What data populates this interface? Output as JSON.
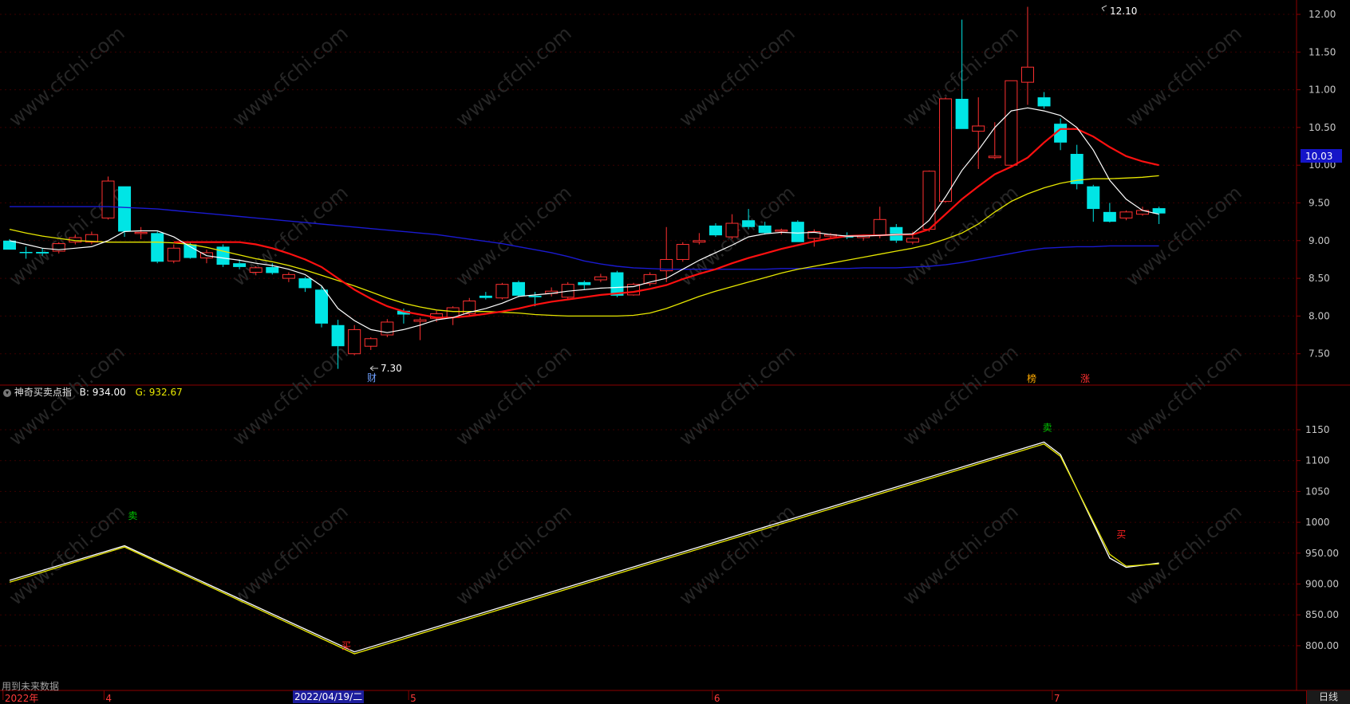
{
  "colors": {
    "up": "#ff3030",
    "down": "#00e5e5",
    "ma5": "#ffffff",
    "ma10": "#ff1010",
    "ma20": "#e6e600",
    "ma60": "#1a1ad0",
    "border": "#8b0000",
    "ind_b": "#ffffff",
    "ind_g": "#e8e800"
  },
  "price_axis": {
    "ticks": [
      "12.00",
      "11.50",
      "11.00",
      "10.50",
      "10.00",
      "9.50",
      "9.00",
      "8.50",
      "8.00",
      "7.50"
    ],
    "current_value": "10.03"
  },
  "annotations": {
    "high_label": "12.10",
    "low_label": "7.30",
    "markers": [
      "财",
      "榜",
      "涨"
    ]
  },
  "indicator": {
    "name": "神奇买卖点指",
    "b_text": "B: 934.00",
    "g_text": "G: 932.67",
    "ticks": [
      "1150",
      "1100",
      "1050",
      "1000",
      "950.00",
      "900.00",
      "850.00",
      "800.00"
    ],
    "signals": [
      "卖",
      "买",
      "卖",
      "买"
    ]
  },
  "x_axis": {
    "labels": [
      "2022年",
      "4",
      "5",
      "6",
      "7"
    ],
    "highlight_date": "2022/04/19/二",
    "period": "日线"
  },
  "notice": "用到未来数据",
  "watermark": "www.cfchi.com",
  "chart_data": [
    {
      "type": "candlestick",
      "ylim": [
        7.1,
        12.15
      ],
      "candles": [
        {
          "o": 9.0,
          "h": 9.02,
          "l": 8.88,
          "c": 8.88,
          "d": 1
        },
        {
          "o": 8.85,
          "h": 8.92,
          "l": 8.76,
          "c": 8.84,
          "d": 1
        },
        {
          "o": 8.85,
          "h": 8.9,
          "l": 8.8,
          "c": 8.83,
          "d": 1
        },
        {
          "o": 8.86,
          "h": 8.98,
          "l": 8.83,
          "c": 8.96,
          "d": 0
        },
        {
          "o": 8.98,
          "h": 9.08,
          "l": 8.95,
          "c": 9.04,
          "d": 0
        },
        {
          "o": 8.98,
          "h": 9.12,
          "l": 8.95,
          "c": 9.08,
          "d": 0
        },
        {
          "o": 9.3,
          "h": 9.85,
          "l": 9.28,
          "c": 9.79,
          "d": 0
        },
        {
          "o": 9.72,
          "h": 9.72,
          "l": 9.05,
          "c": 9.12,
          "d": 1
        },
        {
          "o": 9.1,
          "h": 9.18,
          "l": 9.02,
          "c": 9.11,
          "d": 0
        },
        {
          "o": 9.1,
          "h": 9.12,
          "l": 8.7,
          "c": 8.72,
          "d": 1
        },
        {
          "o": 8.73,
          "h": 8.95,
          "l": 8.7,
          "c": 8.9,
          "d": 0
        },
        {
          "o": 8.95,
          "h": 8.98,
          "l": 8.76,
          "c": 8.77,
          "d": 1
        },
        {
          "o": 8.77,
          "h": 8.88,
          "l": 8.7,
          "c": 8.84,
          "d": 0
        },
        {
          "o": 8.92,
          "h": 8.95,
          "l": 8.65,
          "c": 8.68,
          "d": 1
        },
        {
          "o": 8.7,
          "h": 8.75,
          "l": 8.62,
          "c": 8.65,
          "d": 1
        },
        {
          "o": 8.58,
          "h": 8.66,
          "l": 8.54,
          "c": 8.64,
          "d": 0
        },
        {
          "o": 8.65,
          "h": 8.7,
          "l": 8.55,
          "c": 8.57,
          "d": 1
        },
        {
          "o": 8.5,
          "h": 8.58,
          "l": 8.45,
          "c": 8.55,
          "d": 0
        },
        {
          "o": 8.5,
          "h": 8.52,
          "l": 8.32,
          "c": 8.37,
          "d": 1
        },
        {
          "o": 8.35,
          "h": 8.4,
          "l": 7.85,
          "c": 7.9,
          "d": 1
        },
        {
          "o": 7.88,
          "h": 7.95,
          "l": 7.3,
          "c": 7.6,
          "d": 1
        },
        {
          "o": 7.5,
          "h": 7.88,
          "l": 7.48,
          "c": 7.82,
          "d": 0
        },
        {
          "o": 7.6,
          "h": 7.72,
          "l": 7.55,
          "c": 7.7,
          "d": 0
        },
        {
          "o": 7.75,
          "h": 7.96,
          "l": 7.72,
          "c": 7.92,
          "d": 0
        },
        {
          "o": 8.07,
          "h": 8.1,
          "l": 7.9,
          "c": 8.02,
          "d": 1
        },
        {
          "o": 7.93,
          "h": 7.98,
          "l": 7.68,
          "c": 7.95,
          "d": 0
        },
        {
          "o": 7.97,
          "h": 8.07,
          "l": 7.92,
          "c": 8.03,
          "d": 0
        },
        {
          "o": 7.98,
          "h": 8.13,
          "l": 7.88,
          "c": 8.11,
          "d": 0
        },
        {
          "o": 8.03,
          "h": 8.24,
          "l": 8.0,
          "c": 8.2,
          "d": 0
        },
        {
          "o": 8.27,
          "h": 8.32,
          "l": 8.22,
          "c": 8.24,
          "d": 1
        },
        {
          "o": 8.24,
          "h": 8.44,
          "l": 8.22,
          "c": 8.42,
          "d": 0
        },
        {
          "o": 8.45,
          "h": 8.47,
          "l": 8.25,
          "c": 8.27,
          "d": 1
        },
        {
          "o": 8.27,
          "h": 8.32,
          "l": 8.13,
          "c": 8.25,
          "d": 1
        },
        {
          "o": 8.3,
          "h": 8.38,
          "l": 8.26,
          "c": 8.33,
          "d": 0
        },
        {
          "o": 8.25,
          "h": 8.45,
          "l": 8.22,
          "c": 8.42,
          "d": 0
        },
        {
          "o": 8.45,
          "h": 8.47,
          "l": 8.35,
          "c": 8.41,
          "d": 1
        },
        {
          "o": 8.48,
          "h": 8.56,
          "l": 8.45,
          "c": 8.52,
          "d": 0
        },
        {
          "o": 8.58,
          "h": 8.6,
          "l": 8.25,
          "c": 8.27,
          "d": 1
        },
        {
          "o": 8.28,
          "h": 8.44,
          "l": 8.27,
          "c": 8.42,
          "d": 0
        },
        {
          "o": 8.43,
          "h": 8.58,
          "l": 8.4,
          "c": 8.55,
          "d": 0
        },
        {
          "o": 8.6,
          "h": 9.18,
          "l": 8.45,
          "c": 8.75,
          "d": 0
        },
        {
          "o": 8.75,
          "h": 8.98,
          "l": 8.72,
          "c": 8.95,
          "d": 0
        },
        {
          "o": 8.98,
          "h": 9.1,
          "l": 8.95,
          "c": 9.0,
          "d": 0
        },
        {
          "o": 9.2,
          "h": 9.23,
          "l": 9.05,
          "c": 9.07,
          "d": 1
        },
        {
          "o": 9.05,
          "h": 9.35,
          "l": 9.02,
          "c": 9.23,
          "d": 0
        },
        {
          "o": 9.27,
          "h": 9.42,
          "l": 9.15,
          "c": 9.18,
          "d": 1
        },
        {
          "o": 9.2,
          "h": 9.25,
          "l": 9.08,
          "c": 9.1,
          "d": 1
        },
        {
          "o": 9.13,
          "h": 9.16,
          "l": 9.08,
          "c": 9.14,
          "d": 0
        },
        {
          "o": 9.25,
          "h": 9.27,
          "l": 8.98,
          "c": 8.98,
          "d": 1
        },
        {
          "o": 9.03,
          "h": 9.15,
          "l": 8.92,
          "c": 9.12,
          "d": 0
        },
        {
          "o": 9.06,
          "h": 9.1,
          "l": 9.02,
          "c": 9.08,
          "d": 0
        },
        {
          "o": 9.07,
          "h": 9.11,
          "l": 9.02,
          "c": 9.04,
          "d": 1
        },
        {
          "o": 9.04,
          "h": 9.08,
          "l": 9.0,
          "c": 9.07,
          "d": 0
        },
        {
          "o": 9.07,
          "h": 9.45,
          "l": 9.03,
          "c": 9.28,
          "d": 0
        },
        {
          "o": 9.18,
          "h": 9.22,
          "l": 8.97,
          "c": 9.0,
          "d": 1
        },
        {
          "o": 8.98,
          "h": 9.12,
          "l": 8.95,
          "c": 9.03,
          "d": 0
        },
        {
          "o": 9.15,
          "h": 9.93,
          "l": 9.12,
          "c": 9.92,
          "d": 0
        },
        {
          "o": 9.52,
          "h": 10.9,
          "l": 9.5,
          "c": 10.88,
          "d": 0
        },
        {
          "o": 10.88,
          "h": 11.93,
          "l": 10.48,
          "c": 10.48,
          "d": 1
        },
        {
          "o": 10.45,
          "h": 10.9,
          "l": 9.95,
          "c": 10.52,
          "d": 0
        },
        {
          "o": 10.12,
          "h": 10.57,
          "l": 10.08,
          "c": 10.1,
          "d": 0
        },
        {
          "o": 10.0,
          "h": 11.12,
          "l": 9.98,
          "c": 11.12,
          "d": 0
        },
        {
          "o": 11.1,
          "h": 12.1,
          "l": 10.8,
          "c": 11.3,
          "d": 0
        },
        {
          "o": 10.9,
          "h": 10.97,
          "l": 10.75,
          "c": 10.78,
          "d": 1
        },
        {
          "o": 10.55,
          "h": 10.62,
          "l": 10.2,
          "c": 10.3,
          "d": 1
        },
        {
          "o": 10.15,
          "h": 10.27,
          "l": 9.68,
          "c": 9.75,
          "d": 1
        },
        {
          "o": 9.72,
          "h": 9.74,
          "l": 9.25,
          "c": 9.42,
          "d": 1
        },
        {
          "o": 9.38,
          "h": 9.5,
          "l": 9.24,
          "c": 9.25,
          "d": 1
        },
        {
          "o": 9.3,
          "h": 9.4,
          "l": 9.27,
          "c": 9.38,
          "d": 0
        },
        {
          "o": 9.35,
          "h": 9.45,
          "l": 9.33,
          "c": 9.4,
          "d": 0
        },
        {
          "o": 9.43,
          "h": 9.45,
          "l": 9.22,
          "c": 9.36,
          "d": 1
        }
      ],
      "series": [
        {
          "name": "ma5",
          "values": [
            9.0,
            8.95,
            8.9,
            8.88,
            8.9,
            8.92,
            9.0,
            9.12,
            9.13,
            9.13,
            9.05,
            8.92,
            8.8,
            8.77,
            8.74,
            8.7,
            8.67,
            8.62,
            8.55,
            8.4,
            8.1,
            7.94,
            7.82,
            7.78,
            7.82,
            7.88,
            7.95,
            7.98,
            8.05,
            8.1,
            8.17,
            8.26,
            8.28,
            8.3,
            8.33,
            8.35,
            8.37,
            8.38,
            8.39,
            8.45,
            8.5,
            8.62,
            8.74,
            8.84,
            8.94,
            9.05,
            9.09,
            9.11,
            9.1,
            9.11,
            9.08,
            9.06,
            9.06,
            9.07,
            9.08,
            9.09,
            9.27,
            9.58,
            9.93,
            10.2,
            10.5,
            10.72,
            10.76,
            10.72,
            10.66,
            10.5,
            10.2,
            9.8,
            9.55,
            9.4,
            9.35
          ]
        },
        {
          "name": "ma10",
          "values": [
            null,
            null,
            null,
            null,
            null,
            null,
            null,
            null,
            null,
            null,
            8.98,
            8.98,
            8.98,
            8.98,
            8.98,
            8.95,
            8.9,
            8.83,
            8.75,
            8.65,
            8.5,
            8.35,
            8.23,
            8.13,
            8.06,
            8.02,
            7.98,
            7.98,
            8.0,
            8.03,
            8.06,
            8.1,
            8.15,
            8.19,
            8.22,
            8.25,
            8.28,
            8.3,
            8.32,
            8.36,
            8.41,
            8.49,
            8.56,
            8.62,
            8.7,
            8.77,
            8.83,
            8.89,
            8.94,
            8.99,
            9.03,
            9.06,
            9.07,
            9.07,
            9.08,
            9.08,
            9.15,
            9.35,
            9.55,
            9.72,
            9.88,
            9.98,
            10.1,
            10.3,
            10.48,
            10.48,
            10.38,
            10.24,
            10.12,
            10.05,
            10.0
          ]
        },
        {
          "name": "ma20",
          "values": [
            9.15,
            9.1,
            9.06,
            9.03,
            9.0,
            8.99,
            8.98,
            8.98,
            8.98,
            8.98,
            8.97,
            8.95,
            8.91,
            8.86,
            8.81,
            8.76,
            8.72,
            8.67,
            8.61,
            8.54,
            8.47,
            8.4,
            8.32,
            8.24,
            8.17,
            8.12,
            8.08,
            8.06,
            8.06,
            8.06,
            8.05,
            8.04,
            8.02,
            8.01,
            8.0,
            8.0,
            8.0,
            8.0,
            8.01,
            8.04,
            8.1,
            8.18,
            8.26,
            8.33,
            8.39,
            8.45,
            8.51,
            8.57,
            8.62,
            8.66,
            8.7,
            8.74,
            8.78,
            8.82,
            8.86,
            8.9,
            8.95,
            9.02,
            9.1,
            9.22,
            9.38,
            9.52,
            9.62,
            9.7,
            9.76,
            9.8,
            9.82,
            9.82,
            9.83,
            9.84,
            9.86
          ]
        },
        {
          "name": "ma60",
          "values": [
            9.45,
            9.45,
            9.45,
            9.45,
            9.45,
            9.45,
            9.45,
            9.44,
            9.43,
            9.42,
            9.4,
            9.38,
            9.36,
            9.34,
            9.32,
            9.3,
            9.28,
            9.26,
            9.24,
            9.22,
            9.2,
            9.18,
            9.16,
            9.14,
            9.12,
            9.1,
            9.08,
            9.05,
            9.02,
            8.99,
            8.96,
            8.92,
            8.88,
            8.84,
            8.79,
            8.73,
            8.69,
            8.66,
            8.64,
            8.63,
            8.62,
            8.62,
            8.62,
            8.62,
            8.62,
            8.62,
            8.62,
            8.63,
            8.63,
            8.63,
            8.63,
            8.63,
            8.64,
            8.64,
            8.64,
            8.65,
            8.66,
            8.68,
            8.71,
            8.75,
            8.79,
            8.83,
            8.87,
            8.9,
            8.91,
            8.92,
            8.92,
            8.93,
            8.93,
            8.93,
            8.93
          ]
        }
      ]
    },
    {
      "type": "line",
      "name": "神奇买卖点指",
      "ylim": [
        770,
        1180
      ],
      "series": [
        {
          "name": "B",
          "color": "#ffffff",
          "x": [
            0,
            7,
            21,
            63,
            64,
            67,
            68,
            70
          ],
          "values": [
            906,
            962,
            790,
            1130,
            1110,
            942,
            927,
            934
          ]
        },
        {
          "name": "G",
          "color": "#e8e800",
          "x": [
            0,
            7,
            21,
            63,
            64,
            67,
            68,
            70
          ],
          "values": [
            903,
            960,
            787,
            1127,
            1107,
            948,
            929,
            932.67
          ]
        }
      ],
      "signals": [
        {
          "label": "卖",
          "x": 7.5,
          "y": 1005,
          "color": "#00cc00"
        },
        {
          "label": "买",
          "x": 20.5,
          "y": 795,
          "color": "#ff2020"
        },
        {
          "label": "卖",
          "x": 63.2,
          "y": 1148,
          "color": "#00cc00"
        },
        {
          "label": "买",
          "x": 67.7,
          "y": 975,
          "color": "#ff2020"
        }
      ]
    }
  ]
}
